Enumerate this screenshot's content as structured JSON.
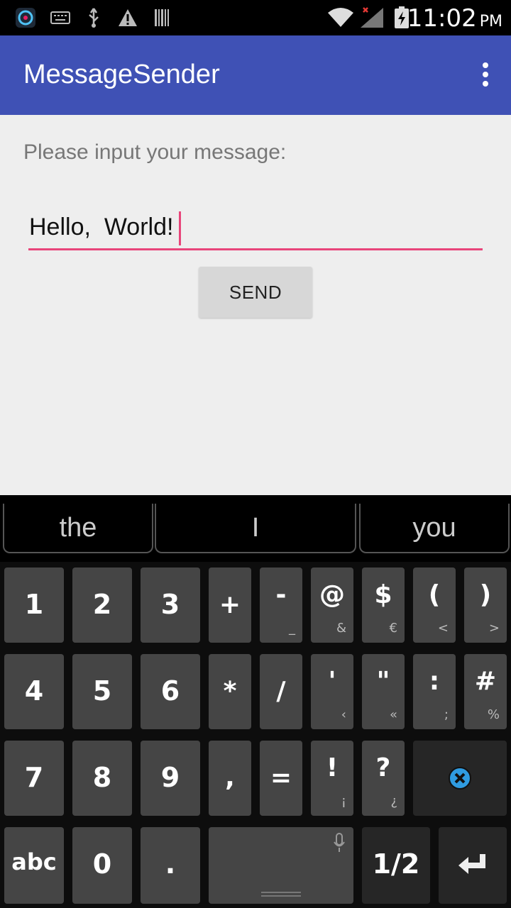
{
  "status_bar": {
    "icons": [
      "app-icon",
      "keyboard-icon",
      "usb-icon",
      "warning-icon",
      "barcode-icon",
      "wifi-icon",
      "signal-icon",
      "battery-icon"
    ],
    "time": "11:02",
    "ampm": "PM"
  },
  "app": {
    "title": "MessageSender"
  },
  "content": {
    "prompt": "Please input your message:",
    "input_value": "Hello,  World!",
    "send_label": "SEND"
  },
  "keyboard": {
    "suggestions": [
      "the",
      "I",
      "you"
    ],
    "rows": [
      [
        {
          "main": "1"
        },
        {
          "main": "2"
        },
        {
          "main": "3"
        },
        {
          "main": "+"
        },
        {
          "main": "-",
          "sub": "_"
        },
        {
          "main": "@",
          "sub": "&"
        },
        {
          "main": "$",
          "sub": "€"
        },
        {
          "main": "(",
          "sub": "<"
        },
        {
          "main": ")",
          "sub": ">"
        }
      ],
      [
        {
          "main": "4"
        },
        {
          "main": "5"
        },
        {
          "main": "6"
        },
        {
          "main": "*"
        },
        {
          "main": "/"
        },
        {
          "main": "'",
          "sub": "‹"
        },
        {
          "main": "\"",
          "sub": "«"
        },
        {
          "main": ":",
          "sub": ";"
        },
        {
          "main": "#",
          "sub": "%"
        }
      ],
      [
        {
          "main": "7"
        },
        {
          "main": "8"
        },
        {
          "main": "9"
        },
        {
          "main": ","
        },
        {
          "main": "="
        },
        {
          "main": "!",
          "sub": "¡"
        },
        {
          "main": "?",
          "sub": "¿"
        }
      ],
      [
        {
          "main": "abc"
        },
        {
          "main": "0"
        },
        {
          "main": "."
        }
      ]
    ],
    "page_label": "1/2"
  }
}
